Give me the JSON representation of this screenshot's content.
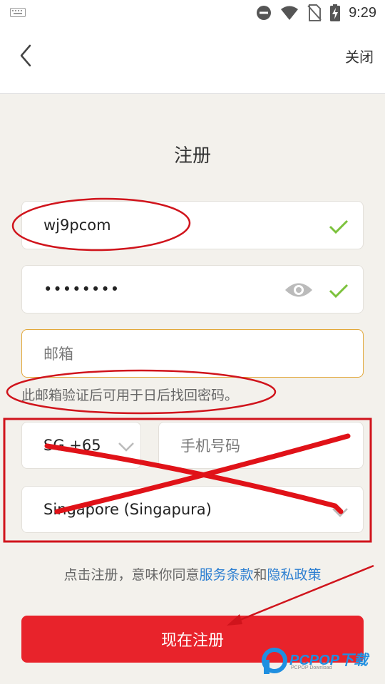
{
  "status": {
    "time": "9:29"
  },
  "header": {
    "close_label": "关闭"
  },
  "page": {
    "title": "注册"
  },
  "form": {
    "username_value": "wj9pcom",
    "password_value": "••••••••",
    "email_placeholder": "邮箱",
    "email_hint": "此邮箱验证后可用于日后找回密码。",
    "country_code": "SG +65",
    "phone_placeholder": "手机号码",
    "country_name": "Singapore (Singapura)"
  },
  "agreement": {
    "prefix": "点击注册，意味你同意",
    "terms_link": "服务条款",
    "and": "和",
    "privacy_link": "隐私政策"
  },
  "register_button": "现在注册",
  "watermark": {
    "brand": "PCPOP下载",
    "sub": "PCPOP Download"
  },
  "colors": {
    "accent_red": "#e8232b",
    "link_blue": "#2d7fd1",
    "focus_orange": "#e2a83a",
    "check_green": "#7cc23c"
  }
}
